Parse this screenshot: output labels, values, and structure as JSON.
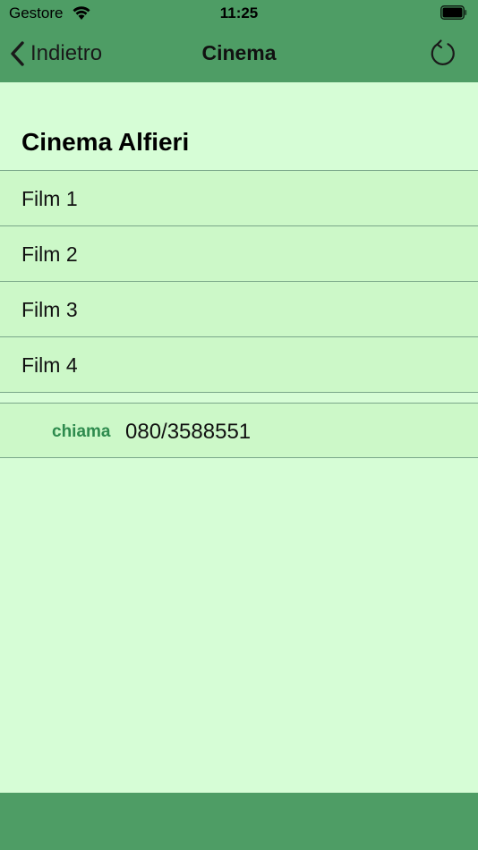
{
  "status_bar": {
    "carrier": "Gestore",
    "time": "11:25"
  },
  "nav": {
    "back_label": "Indietro",
    "title": "Cinema"
  },
  "section": {
    "title": "Cinema Alfieri"
  },
  "films": [
    {
      "label": "Film 1"
    },
    {
      "label": "Film 2"
    },
    {
      "label": "Film 3"
    },
    {
      "label": "Film 4"
    }
  ],
  "contact": {
    "key": "chiama",
    "value": "080/3588551"
  },
  "colors": {
    "bar_green": "#4e9d65",
    "background": "#d6fdd6",
    "row_bg": "#ccf8c8",
    "accent": "#2e8b4e"
  }
}
